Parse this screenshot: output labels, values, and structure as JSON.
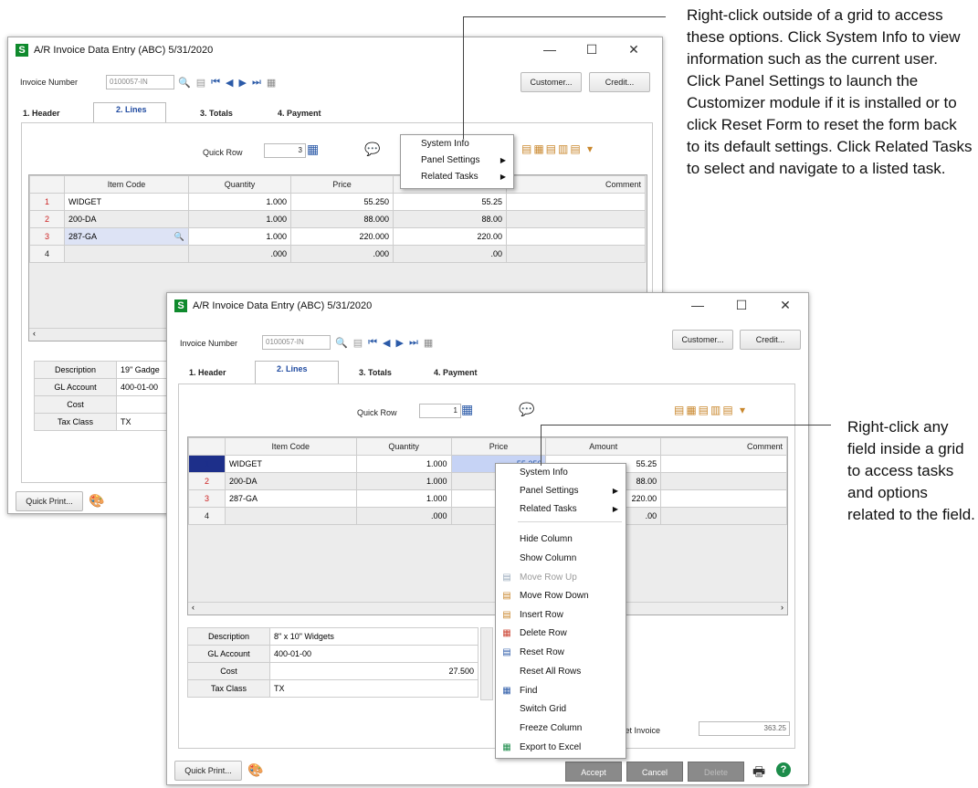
{
  "callouts": {
    "top": "Right-click outside of a grid to access these options. Click System Info to view information such as the current user. Click Panel Settings to launch the Customizer module if it is installed or to click Reset Form to reset the form back to its default settings. Click Related Tasks to select and navigate to a listed task.",
    "right": "Right-click any field inside a grid to access tasks and options related to the field."
  },
  "window": {
    "title": "A/R Invoice Data Entry (ABC) 5/31/2020",
    "app_glyph": "S",
    "min_glyph": "—",
    "max_glyph": "☐",
    "close_glyph": "✕",
    "invoice_label": "Invoice Number",
    "invoice_value": "0100057-IN",
    "customer_button": "Customer...",
    "credit_button": "Credit...",
    "tabs": [
      "1. Header",
      "2. Lines",
      "3. Totals",
      "4. Payment"
    ],
    "quick_row_label": "Quick Row",
    "quick_row_value": "3",
    "back_quick_row_value": "3",
    "front_quick_row_value": "1",
    "quick_print": "Quick Print...",
    "accept": "Accept",
    "cancel": "Cancel",
    "delete": "Delete",
    "net_invoice_label": "Net Invoice",
    "net_invoice_value": "363.25"
  },
  "grid": {
    "columns": [
      "Item Code",
      "Quantity",
      "Price",
      "Amount",
      "Comment"
    ],
    "rows": [
      {
        "n": "1",
        "item": "WIDGET",
        "qty": "1.000",
        "price": "55.250",
        "amount": "55.25"
      },
      {
        "n": "2",
        "item": "200-DA",
        "qty": "1.000",
        "price": "88.000",
        "amount": "88.00"
      },
      {
        "n": "3",
        "item": "287-GA",
        "qty": "1.000",
        "price": "220.000",
        "amount": "220.00"
      },
      {
        "n": "4",
        "item": "",
        "qty": ".000",
        "price": ".000",
        "amount": ".00"
      }
    ],
    "front_amounts": [
      "55.25",
      "88.00",
      "220.00",
      ".00"
    ],
    "front_price_selected": "55.250"
  },
  "details_back": {
    "labels": [
      "Description",
      "GL Account",
      "Cost",
      "Tax Class"
    ],
    "values": [
      "19\" Gadge",
      "400-01-00",
      "",
      "TX"
    ]
  },
  "details_front": {
    "labels": [
      "Description",
      "GL Account",
      "Cost",
      "Tax Class"
    ],
    "values": [
      "8\" x 10\" Widgets",
      "400-01-00",
      "27.500",
      "TX"
    ]
  },
  "outside_menu": {
    "items": [
      "System Info",
      "Panel Settings",
      "Related Tasks"
    ]
  },
  "grid_menu": {
    "items": [
      "System Info",
      "Panel Settings",
      "Related Tasks",
      "Hide Column",
      "Show Column",
      "Move Row Up",
      "Move Row Down",
      "Insert Row",
      "Delete Row",
      "Reset Row",
      "Reset All Rows",
      "Find",
      "Switch Grid",
      "Freeze Column",
      "Export to Excel"
    ]
  }
}
